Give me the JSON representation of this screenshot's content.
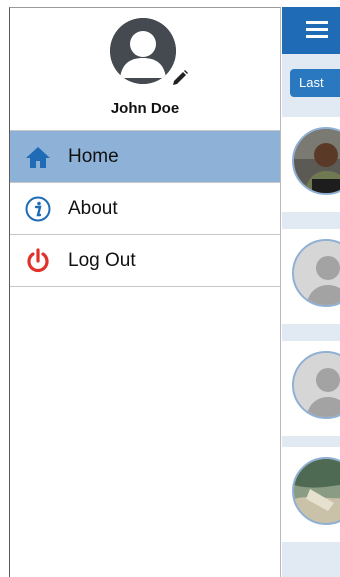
{
  "drawer": {
    "user_name": "John Doe",
    "menu": [
      {
        "label": "Home",
        "icon": "home-icon",
        "active": true
      },
      {
        "label": "About",
        "icon": "info-icon",
        "active": false
      },
      {
        "label": "Log Out",
        "icon": "power-icon",
        "active": false
      }
    ]
  },
  "main": {
    "filter_button": "Last"
  },
  "colors": {
    "accent": "#1f6bb5",
    "active_item": "#8eb1d7",
    "logout_red": "#e0322b",
    "list_bg": "#e1e9f3"
  }
}
